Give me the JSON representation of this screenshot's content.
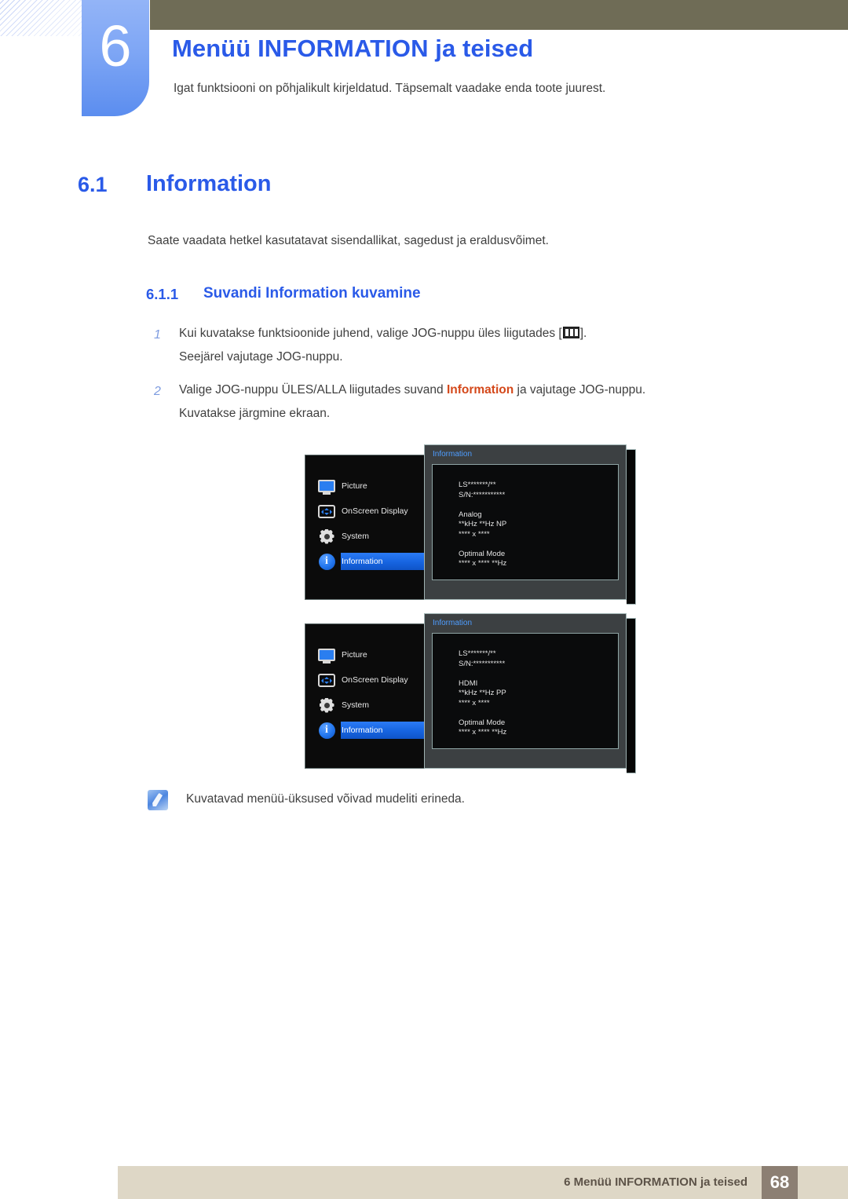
{
  "chapter": {
    "number": "6",
    "title": "Menüü INFORMATION ja teised",
    "intro": "Igat funktsiooni on põhjalikult kirjeldatud. Täpsemalt vaadake enda toote juurest."
  },
  "section": {
    "number": "6.1",
    "title": "Information",
    "body": "Saate vaadata hetkel kasutatavat sisendallikat, sagedust ja eraldusvõimet."
  },
  "subsection": {
    "number": "6.1.1",
    "title": "Suvandi Information kuvamine"
  },
  "steps": [
    {
      "num": "1",
      "line1_before": "Kui kuvatakse funktsioonide juhend, valige JOG-nuppu üles liigutades [",
      "icon": "menu-glyph-icon",
      "line1_after": "].",
      "line2": "Seejärel vajutage JOG-nuppu."
    },
    {
      "num": "2",
      "line1_before": "Valige JOG-nuppu ÜLES/ALLA liigutades suvand ",
      "highlight": "Information",
      "line1_after": " ja vajutage JOG-nuppu.",
      "line2": "Kuvatakse järgmine ekraan."
    }
  ],
  "osd_screens": [
    {
      "menu_items": [
        {
          "icon": "monitor-icon",
          "label": "Picture",
          "selected": false
        },
        {
          "icon": "osd-arrows-icon",
          "label": "OnScreen Display",
          "selected": false
        },
        {
          "icon": "gear-icon",
          "label": "System",
          "selected": false
        },
        {
          "icon": "info-circle-icon",
          "label": "Information",
          "selected": true
        }
      ],
      "panel_title": "Information",
      "panel_text": "LS*******/**\nS/N:***********\n\nAnalog\n**kHz **Hz NP\n**** x ****\n\nOptimal Mode\n**** x **** **Hz"
    },
    {
      "menu_items": [
        {
          "icon": "monitor-icon",
          "label": "Picture",
          "selected": false
        },
        {
          "icon": "osd-arrows-icon",
          "label": "OnScreen Display",
          "selected": false
        },
        {
          "icon": "gear-icon",
          "label": "System",
          "selected": false
        },
        {
          "icon": "info-circle-icon",
          "label": "Information",
          "selected": true
        }
      ],
      "panel_title": "Information",
      "panel_text": "LS*******/**\nS/N:***********\n\nHDMI\n**kHz **Hz PP\n**** x ****\n\nOptimal Mode\n**** x **** **Hz"
    }
  ],
  "note": {
    "icon": "note-pen-icon",
    "text": "Kuvatavad menüü-üksused võivad mudeliti erineda."
  },
  "footer": {
    "text": "6 Menüü INFORMATION ja teised",
    "page": "68"
  },
  "colors": {
    "accent_blue": "#2a5ae8",
    "olive": "#6f6c56",
    "highlight_orange": "#d4481a",
    "footer_bg": "#ded7c6",
    "footer_page_bg": "#8c7f73",
    "osd_selected": "#1664e0"
  }
}
